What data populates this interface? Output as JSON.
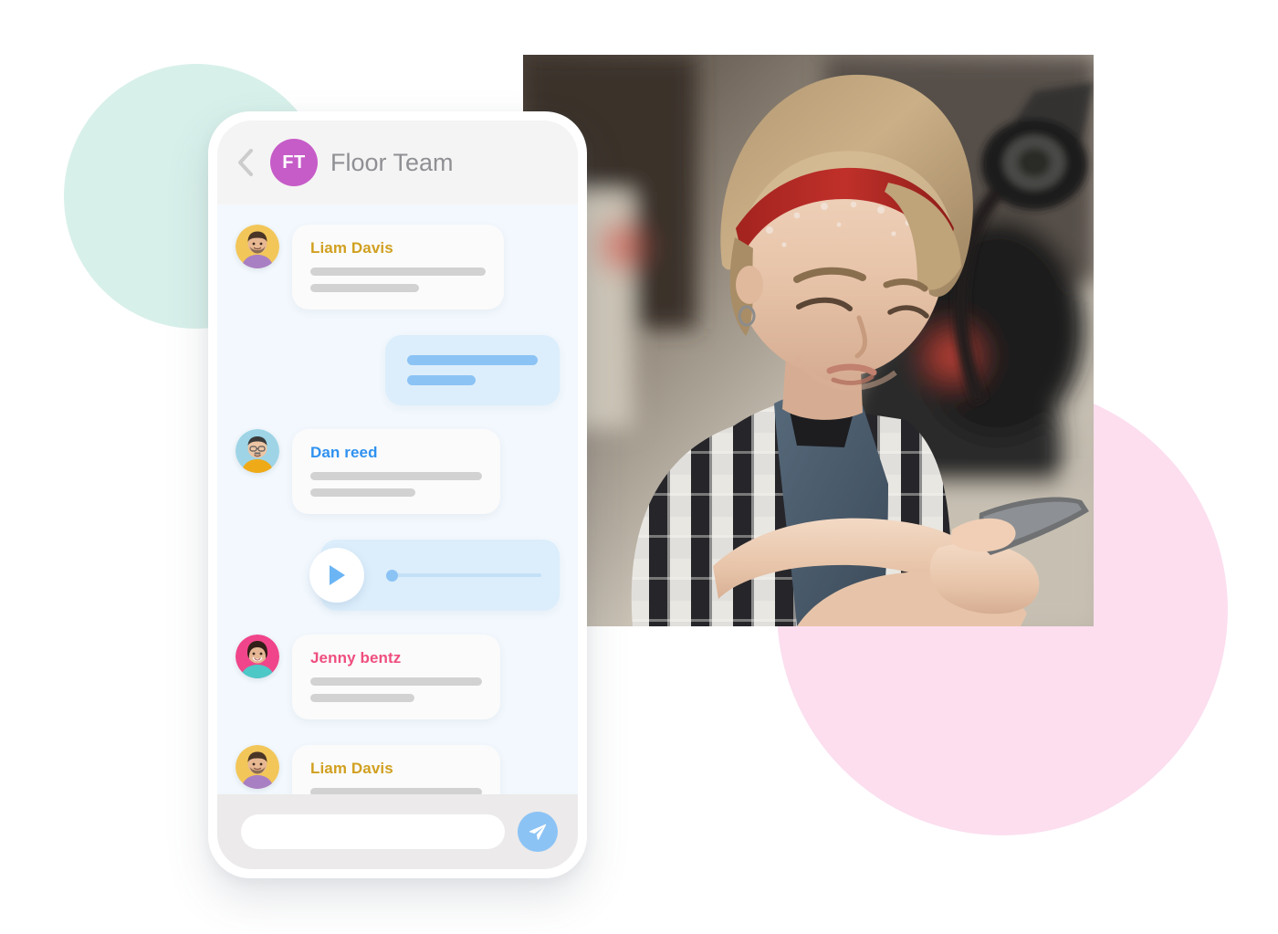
{
  "decor": {
    "mint_circle_color": "#d8f0ea",
    "pink_circle_color": "#fcdeef"
  },
  "photo": {
    "alt": "Woman mechanic with red bandana headband and plaid shirt looking at a smartphone in an auto repair shop"
  },
  "phone": {
    "header": {
      "back_label": "<",
      "avatar_initials": "FT",
      "avatar_color": "#c65cc8",
      "title": "Floor Team"
    },
    "messages": [
      {
        "type": "incoming",
        "sender": "Liam Davis",
        "sender_color": "#d1a020",
        "avatar_bg": "#f2c659",
        "avatar_shirt": "#a97fc4",
        "lines": [
          100,
          62
        ]
      },
      {
        "type": "outgoing",
        "lines": [
          100,
          52
        ]
      },
      {
        "type": "incoming",
        "sender": "Dan reed",
        "sender_color": "#2f92f0",
        "avatar_bg": "#9ed4e6",
        "avatar_shirt": "#efaa17",
        "lines": [
          100,
          61
        ]
      },
      {
        "type": "audio",
        "progress": 0
      },
      {
        "type": "incoming",
        "sender": "Jenny bentz",
        "sender_color": "#ef4e7f",
        "avatar_bg": "#f0458a",
        "avatar_shirt": "#4ec7c7",
        "lines": [
          100,
          61
        ]
      },
      {
        "type": "incoming",
        "sender": "Liam Davis",
        "sender_color": "#d1a020",
        "avatar_bg": "#f2c659",
        "avatar_shirt": "#a97fc4",
        "lines": [
          100,
          61
        ]
      },
      {
        "type": "outgoing",
        "lines": [
          100,
          52
        ]
      }
    ],
    "composer": {
      "input_value": "",
      "input_placeholder": "",
      "send_color": "#8cc3f5"
    }
  }
}
